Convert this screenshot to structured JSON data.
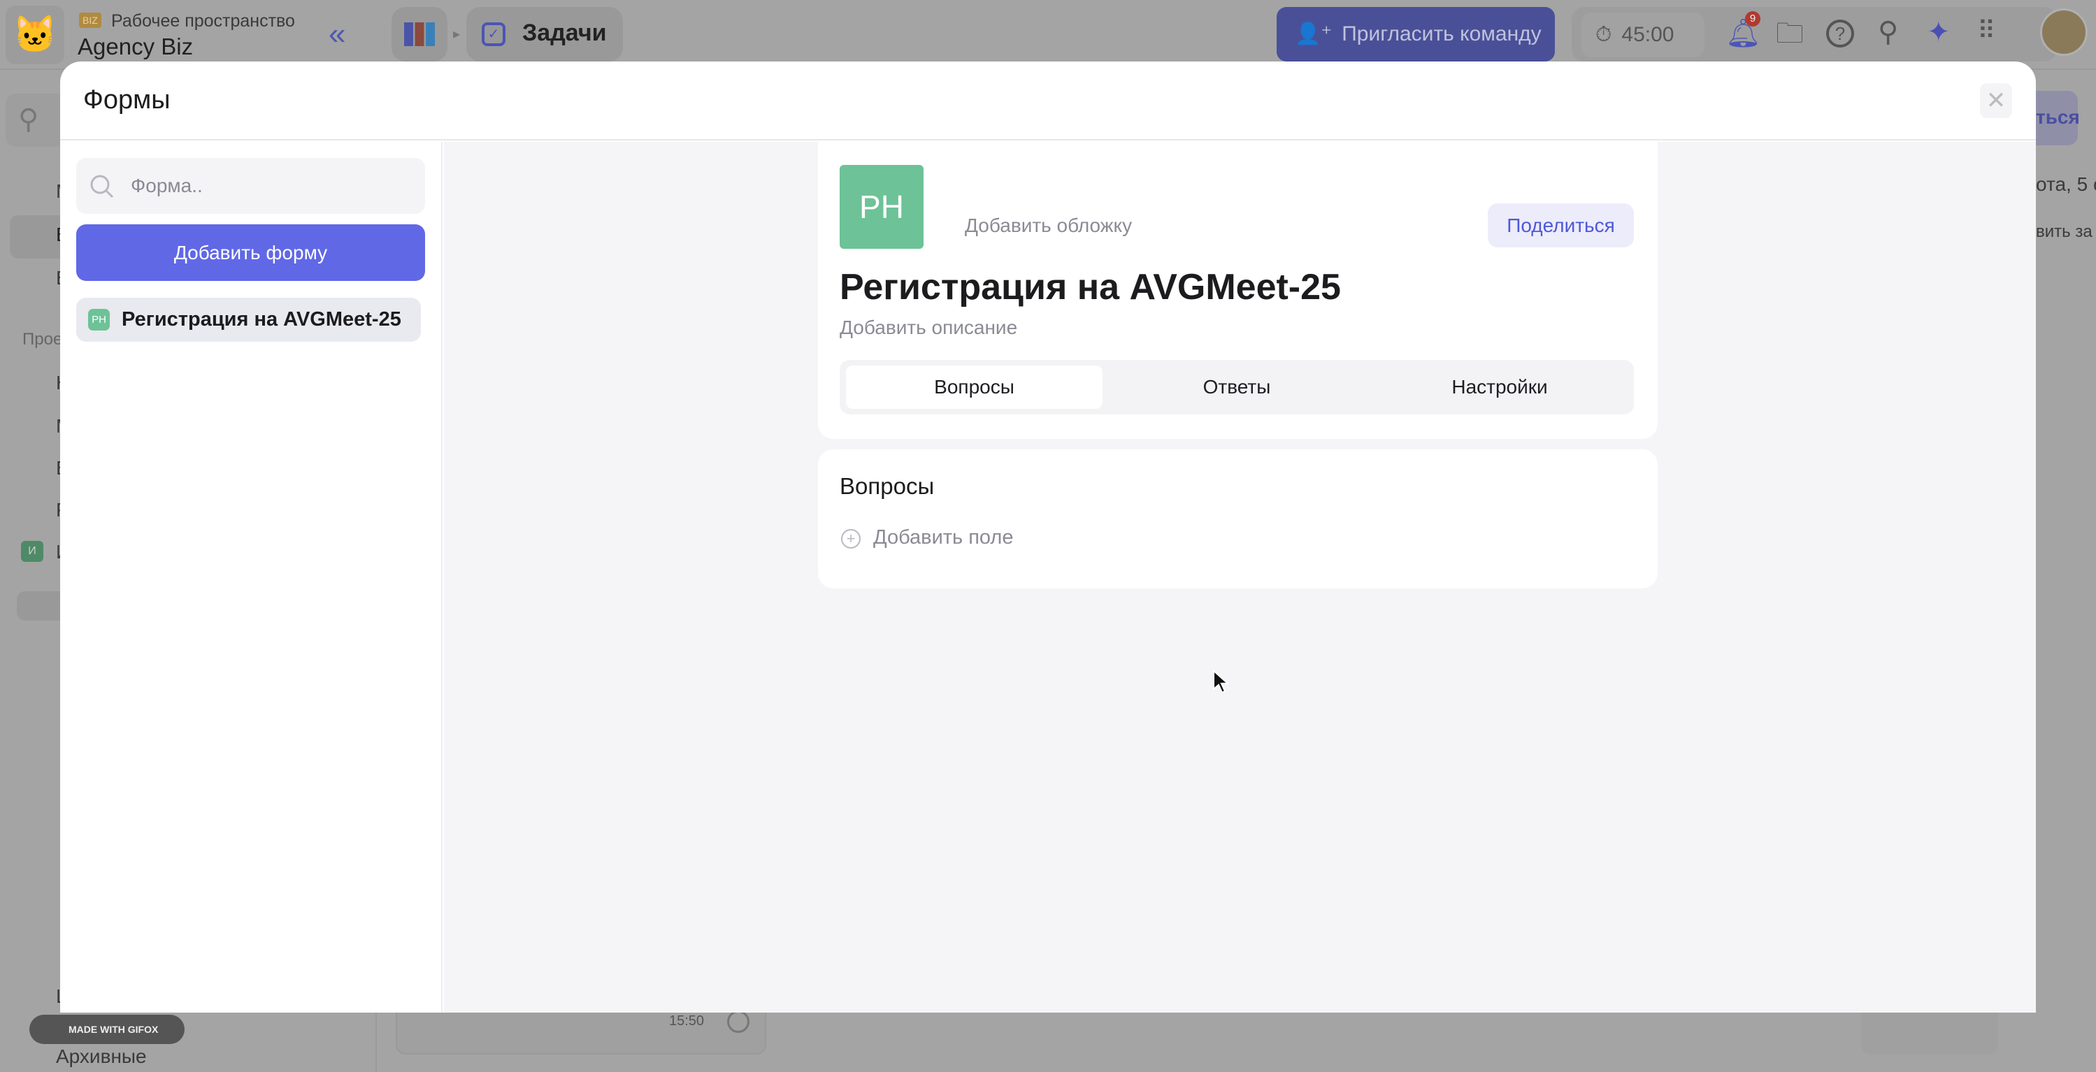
{
  "app": {
    "workspace_badge": "BIZ",
    "workspace_label": "Рабочее пространство",
    "workspace_name": "Agency Biz",
    "breadcrumb_current": "Задачи",
    "invite_label": "Пригласить команду",
    "timer": "45:00",
    "notification_count": "9",
    "sidebar_letters": [
      "М",
      "В",
      "В"
    ],
    "projects_label": "Прое",
    "project_letters": [
      "Н",
      "М",
      "В",
      "Р",
      "И"
    ],
    "project_badge": "И",
    "bottom_letters": [
      "L",
      "Архивные"
    ],
    "right_partial": [
      "ться",
      "ота, 5 с",
      "вить за"
    ],
    "task_time": "15:50",
    "watermark": "MADE WITH GIFOX"
  },
  "modal": {
    "title": "Формы",
    "search_placeholder": "Форма..",
    "search_value": "",
    "add_form_label": "Добавить форму",
    "forms": [
      {
        "badge": "PH",
        "label": "Регистрация на AVGMeet-25"
      }
    ],
    "form": {
      "avatar": "PH",
      "add_cover": "Добавить обложку",
      "share_label": "Поделиться",
      "title": "Регистрация на AVGMeet-25",
      "add_description": "Добавить описание",
      "tabs": [
        {
          "label": "Вопросы",
          "active": true
        },
        {
          "label": "Ответы",
          "active": false
        },
        {
          "label": "Настройки",
          "active": false
        }
      ],
      "questions_heading": "Вопросы",
      "add_field_label": "Добавить поле"
    }
  },
  "colors": {
    "accent": "#6068e6",
    "avatar": "#6dc297",
    "share_bg": "#ececfb"
  }
}
